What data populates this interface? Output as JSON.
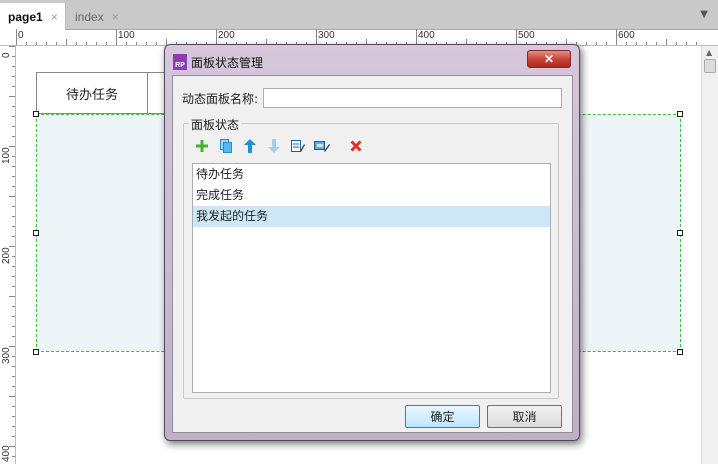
{
  "tabs": [
    {
      "label": "page1",
      "active": true
    },
    {
      "label": "index",
      "active": false
    }
  ],
  "tab_close_glyph": "×",
  "ruler": {
    "horizontal_labels": [
      "0",
      "100",
      "200",
      "300",
      "400",
      "500",
      "600"
    ],
    "vertical_labels": [
      "0",
      "100",
      "200",
      "300",
      "400"
    ]
  },
  "canvas": {
    "tab_labels": [
      "待办任务",
      ""
    ],
    "panel_color": "#eef5f8",
    "selection_color": "#3ec23e"
  },
  "dialog": {
    "logo_text": "RP",
    "title": "面板状态管理",
    "close_glyph": "✕",
    "name_label": "动态面板名称:",
    "name_value": "",
    "group_label": "面板状态",
    "toolbar_icons": [
      "add-icon",
      "duplicate-icon",
      "move-up-icon",
      "move-down-icon",
      "edit-icon",
      "edit-all-icon",
      "delete-icon"
    ],
    "states": [
      "待办任务",
      "完成任务",
      "我发起的任务"
    ],
    "selected_state_index": 2,
    "ok_label": "确定",
    "cancel_label": "取消",
    "accent_color": "#8c3bb3"
  }
}
